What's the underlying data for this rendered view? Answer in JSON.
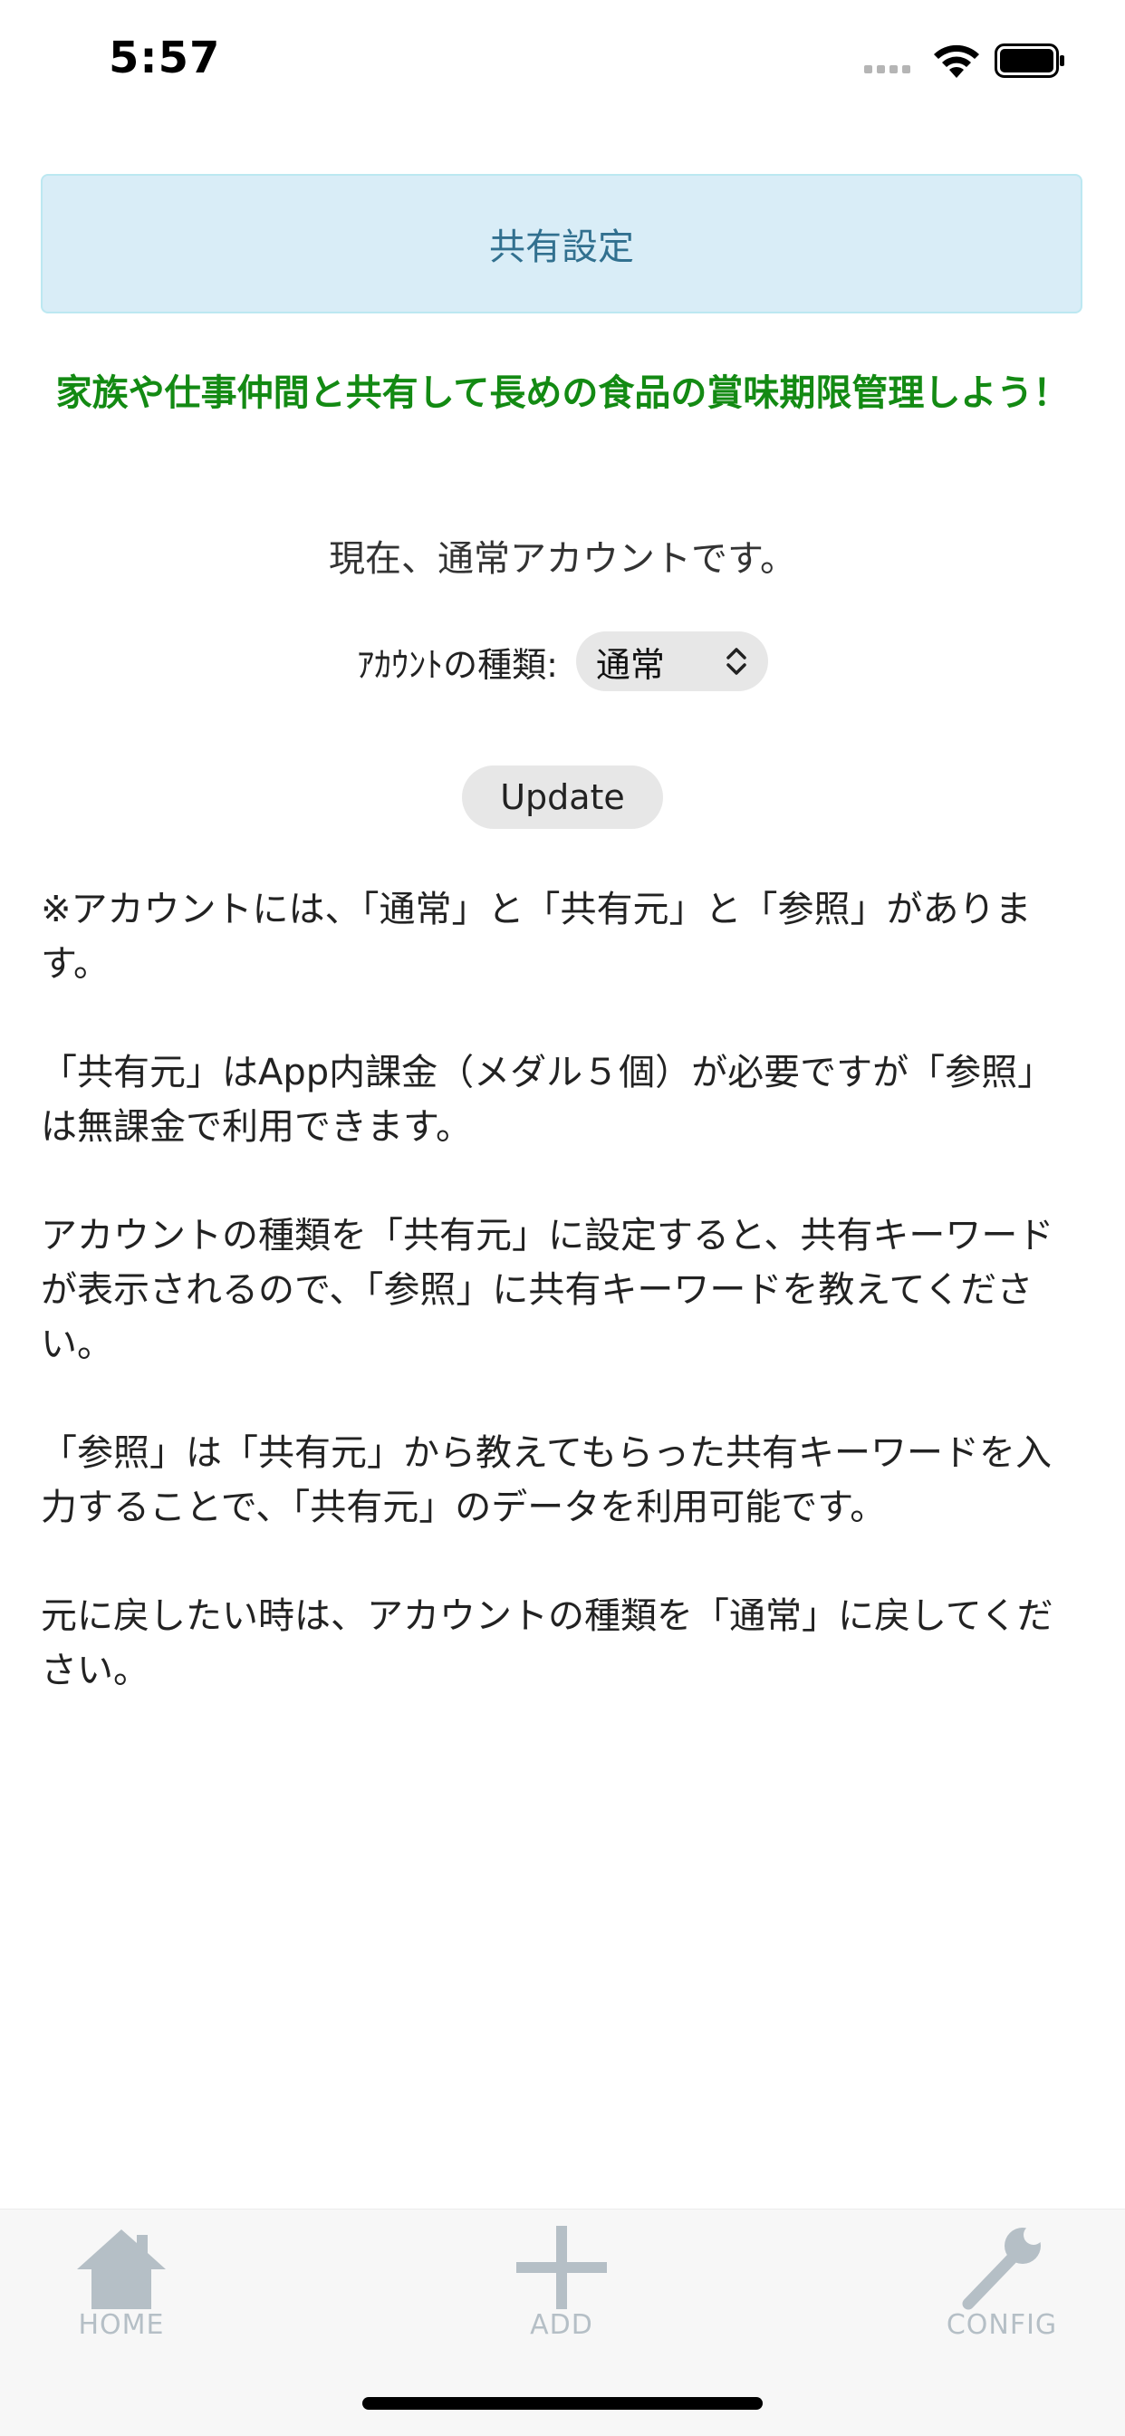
{
  "status_bar": {
    "time": "5:57"
  },
  "header": {
    "title": "共有設定"
  },
  "promo_text": "家族や仕事仲間と共有して長めの食品の賞味期限管理しよう！",
  "current_status": "現在、通常アカウントです。",
  "account_type": {
    "label": "ｱｶｳﾝﾄの種類:",
    "selected": "通常"
  },
  "update_button": "Update",
  "notes": [
    "※アカウントには、「通常」と「共有元」と「参照」があります。",
    "「共有元」はApp内課金（メダル５個）が必要ですが「参照」は無課金で利用できます。",
    "アカウントの種類を「共有元」に設定すると、共有キーワードが表示されるので、「参照」に共有キーワードを教えてください。",
    "「参照」は「共有元」から教えてもらった共有キーワードを入力することで、「共有元」のデータを利用可能です。",
    "元に戻したい時は、アカウントの種類を「通常」に戻してください。"
  ],
  "tab_bar": {
    "home": "HOME",
    "add": "ADD",
    "config": "CONFIG"
  },
  "colors": {
    "header_bg": "#d9edf7",
    "header_text": "#31708f",
    "promo_text": "#138a13",
    "tab_icon": "#b5bfc6"
  },
  "icons": {
    "home": "home-icon",
    "add": "plus-icon",
    "config": "wrench-icon",
    "wifi": "wifi-icon",
    "battery": "battery-icon",
    "select": "chevron-up-down-icon"
  }
}
